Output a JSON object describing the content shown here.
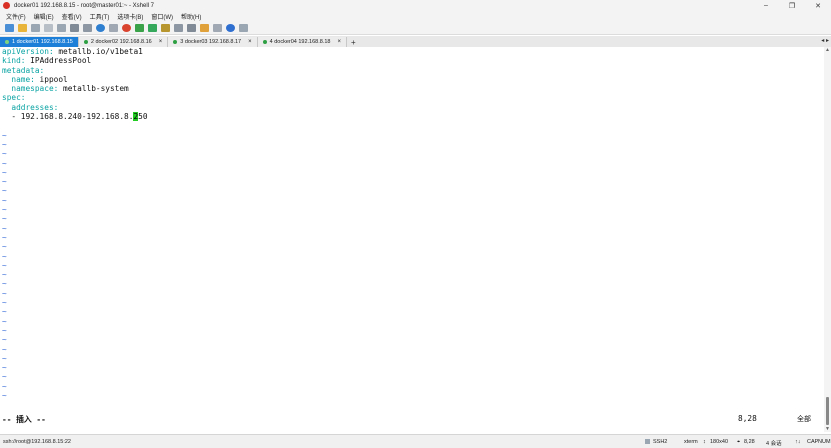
{
  "window": {
    "title": "docker01 192.168.8.15 - root@master01:~ - Xshell 7",
    "controls": [
      "–",
      "❐",
      "✕"
    ]
  },
  "menu": [
    "文件(F)",
    "编辑(E)",
    "查看(V)",
    "工具(T)",
    "选项卡(B)",
    "窗口(W)",
    "帮助(H)"
  ],
  "tabs": [
    {
      "label": "1 docker01 192.168.8.15",
      "active": true
    },
    {
      "label": "2 docker02 192.168.8.16",
      "active": false
    },
    {
      "label": "3 docker03 192.168.8.17",
      "active": false
    },
    {
      "label": "4 docker04 192.168.8.18",
      "active": false
    }
  ],
  "terminal": {
    "l1_key": "apiVersion:",
    "l1_val": " metallb.io/v1beta1",
    "l2_key": "kind:",
    "l2_val": " IPAddressPool",
    "l3_key": "metadata:",
    "l4_key": "  name:",
    "l4_val": " ippool",
    "l5_key": "  namespace:",
    "l5_val": " metallb-system",
    "l6_key": "spec:",
    "l7_key": "  addresses:",
    "l8_pre": "  - 192.168.8.240-192.168.8.",
    "l8_cursor": "2",
    "l8_post": "50",
    "tilde": "~",
    "mode": "-- 插入 --",
    "position": "8,28",
    "scroll_label": "全部"
  },
  "statusbar": {
    "connection": "ssh://root@192.168.8.15:22",
    "protocol": "SSH2",
    "term": "xterm",
    "size": "180x40",
    "cursor": "8,28",
    "sessions": "4 会话",
    "caps": "CAP",
    "num": "NUM"
  },
  "colors": {
    "accent": "#1e7fd8",
    "yaml_key": "#0aa3a3",
    "tilde": "#3a6ed8",
    "cursor": "#22cc22"
  }
}
